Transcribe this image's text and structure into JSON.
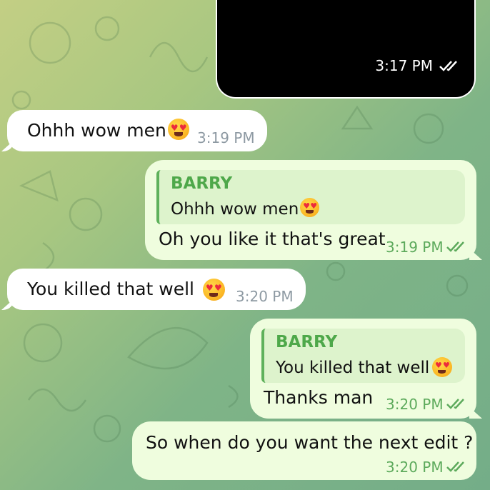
{
  "colors": {
    "incoming": "#ffffff",
    "outgoing": "#effdde",
    "accent": "#4ea84a"
  },
  "video": {
    "time": "3:17 PM",
    "status": "read"
  },
  "messages": [
    {
      "direction": "in",
      "text": "Ohhh wow men",
      "emoji": "smiling-face-with-heart-eyes",
      "time": "3:19 PM"
    },
    {
      "direction": "out",
      "reply_author": "BARRY",
      "reply_text": "Ohhh wow men",
      "reply_emoji": "smiling-face-with-heart-eyes",
      "text": "Oh you like it that's great",
      "time": "3:19 PM",
      "status": "read"
    },
    {
      "direction": "in",
      "text": "You killed that well",
      "emoji": "smiling-face-with-heart-eyes",
      "time": "3:20 PM"
    },
    {
      "direction": "out",
      "reply_author": "BARRY",
      "reply_text": "You killed that well",
      "reply_emoji": "smiling-face-with-heart-eyes",
      "text": "Thanks man",
      "time": "3:20 PM",
      "status": "read"
    },
    {
      "direction": "out",
      "text": "So when do you want the next edit ?",
      "time": "3:20 PM",
      "status": "read"
    }
  ]
}
